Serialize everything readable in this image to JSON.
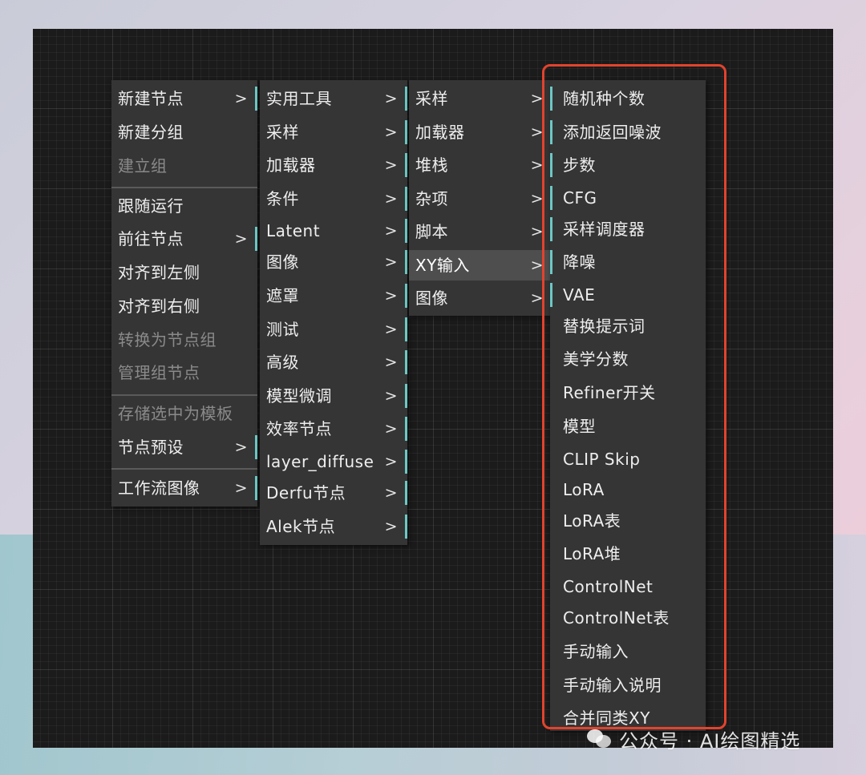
{
  "menu1": {
    "items": [
      {
        "label": "新建节点",
        "arrow": ">",
        "disabled": false
      },
      {
        "label": "新建分组",
        "disabled": false
      },
      {
        "label": "建立组",
        "disabled": true
      },
      {
        "label": "跟随运行",
        "disabled": false
      },
      {
        "label": "前往节点",
        "arrow": ">",
        "disabled": false
      },
      {
        "label": "对齐到左侧",
        "disabled": false
      },
      {
        "label": "对齐到右侧",
        "disabled": false
      },
      {
        "label": "转换为节点组",
        "disabled": true
      },
      {
        "label": "管理组节点",
        "disabled": true
      },
      {
        "label": "存储选中为模板",
        "disabled": true
      },
      {
        "label": "节点预设",
        "arrow": ">",
        "disabled": false
      },
      {
        "label": "工作流图像",
        "arrow": ">",
        "disabled": false
      }
    ]
  },
  "menu2": {
    "items": [
      {
        "label": "实用工具",
        "arrow": ">"
      },
      {
        "label": "采样",
        "arrow": ">"
      },
      {
        "label": "加载器",
        "arrow": ">"
      },
      {
        "label": "条件",
        "arrow": ">"
      },
      {
        "label": "Latent",
        "arrow": ">"
      },
      {
        "label": "图像",
        "arrow": ">"
      },
      {
        "label": "遮罩",
        "arrow": ">"
      },
      {
        "label": "测试",
        "arrow": ">"
      },
      {
        "label": "高级",
        "arrow": ">"
      },
      {
        "label": "模型微调",
        "arrow": ">"
      },
      {
        "label": "效率节点",
        "arrow": ">"
      },
      {
        "label": "layer_diffuse",
        "arrow": ">"
      },
      {
        "label": "Derfu节点",
        "arrow": ">"
      },
      {
        "label": "Alek节点",
        "arrow": ">"
      }
    ]
  },
  "menu3": {
    "items": [
      {
        "label": "采样",
        "arrow": ">"
      },
      {
        "label": "加载器",
        "arrow": ">"
      },
      {
        "label": "堆栈",
        "arrow": ">"
      },
      {
        "label": "杂项",
        "arrow": ">"
      },
      {
        "label": "脚本",
        "arrow": ">"
      },
      {
        "label": "XY输入",
        "arrow": ">"
      },
      {
        "label": "图像",
        "arrow": ">"
      }
    ]
  },
  "menu4": {
    "items": [
      {
        "label": "随机种个数"
      },
      {
        "label": "添加返回噪波"
      },
      {
        "label": "步数"
      },
      {
        "label": "CFG"
      },
      {
        "label": "采样调度器"
      },
      {
        "label": "降噪"
      },
      {
        "label": "VAE"
      },
      {
        "label": "替换提示词"
      },
      {
        "label": "美学分数"
      },
      {
        "label": "Refiner开关"
      },
      {
        "label": "模型"
      },
      {
        "label": "CLIP Skip"
      },
      {
        "label": "LoRA"
      },
      {
        "label": "LoRA表"
      },
      {
        "label": "LoRA堆"
      },
      {
        "label": "ControlNet"
      },
      {
        "label": "ControlNet表"
      },
      {
        "label": "手动输入"
      },
      {
        "label": "手动输入说明"
      },
      {
        "label": "合并同类XY"
      }
    ]
  },
  "watermark": {
    "text": "公众号 · AI绘图精选"
  },
  "colors": {
    "accent": "#6cc8c4",
    "highlight_border": "#e2432e",
    "menu_bg": "#353535",
    "canvas_bg": "#1b1b1b"
  }
}
